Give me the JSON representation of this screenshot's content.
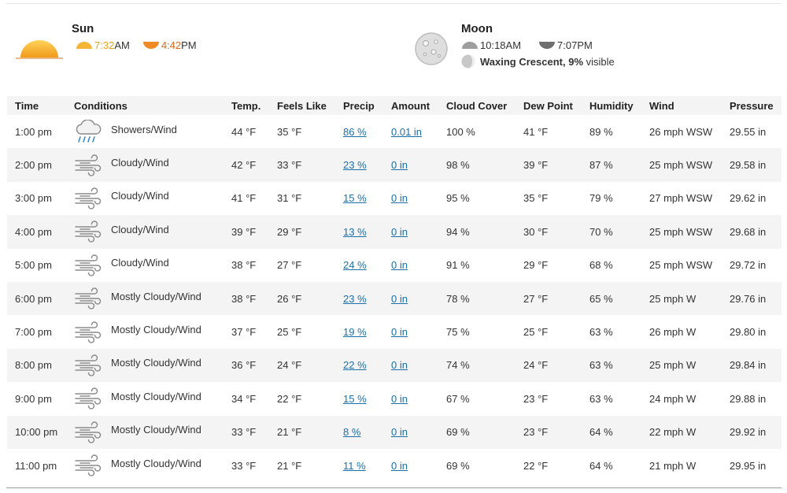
{
  "astronomy": {
    "sun": {
      "title": "Sun",
      "sunrise_time": "7:32",
      "sunrise_ampm": "AM",
      "sunset_time": "4:42",
      "sunset_ampm": "PM",
      "colors": {
        "sunrise": "#e8a317",
        "sunset": "#d2691e"
      }
    },
    "moon": {
      "title": "Moon",
      "moonrise": "10:18AM",
      "moonset": "7:07PM",
      "phase_name": "Waxing Crescent,",
      "phase_percent": "9%",
      "phase_suffix": "visible"
    }
  },
  "table": {
    "headers": [
      "Time",
      "Conditions",
      "Temp.",
      "Feels Like",
      "Precip",
      "Amount",
      "Cloud Cover",
      "Dew Point",
      "Humidity",
      "Wind",
      "Pressure"
    ],
    "rows": [
      {
        "time": "1:00 pm",
        "icon": "showers-wind-icon",
        "conditions": "Showers/Wind",
        "temp": "44 °F",
        "feels": "35 °F",
        "precip": "86 %",
        "amount": "0.01 in",
        "cloud": "100 %",
        "dew": "41 °F",
        "humidity": "89 %",
        "wind": "26 mph WSW",
        "pressure": "29.55 in"
      },
      {
        "time": "2:00 pm",
        "icon": "wind-icon",
        "conditions": "Cloudy/Wind",
        "temp": "42 °F",
        "feels": "33 °F",
        "precip": "23 %",
        "amount": "0 in",
        "cloud": "98 %",
        "dew": "39 °F",
        "humidity": "87 %",
        "wind": "25 mph WSW",
        "pressure": "29.58 in"
      },
      {
        "time": "3:00 pm",
        "icon": "wind-icon",
        "conditions": "Cloudy/Wind",
        "temp": "41 °F",
        "feels": "31 °F",
        "precip": "15 %",
        "amount": "0 in",
        "cloud": "95 %",
        "dew": "35 °F",
        "humidity": "79 %",
        "wind": "27 mph WSW",
        "pressure": "29.62 in"
      },
      {
        "time": "4:00 pm",
        "icon": "wind-icon",
        "conditions": "Cloudy/Wind",
        "temp": "39 °F",
        "feels": "29 °F",
        "precip": "13 %",
        "amount": "0 in",
        "cloud": "94 %",
        "dew": "30 °F",
        "humidity": "70 %",
        "wind": "25 mph WSW",
        "pressure": "29.68 in"
      },
      {
        "time": "5:00 pm",
        "icon": "wind-icon",
        "conditions": "Cloudy/Wind",
        "temp": "38 °F",
        "feels": "27 °F",
        "precip": "24 %",
        "amount": "0 in",
        "cloud": "91 %",
        "dew": "29 °F",
        "humidity": "68 %",
        "wind": "25 mph WSW",
        "pressure": "29.72 in"
      },
      {
        "time": "6:00 pm",
        "icon": "wind-icon",
        "conditions": "Mostly Cloudy/Wind",
        "temp": "38 °F",
        "feels": "26 °F",
        "precip": "23 %",
        "amount": "0 in",
        "cloud": "78 %",
        "dew": "27 °F",
        "humidity": "65 %",
        "wind": "25 mph W",
        "pressure": "29.76 in"
      },
      {
        "time": "7:00 pm",
        "icon": "wind-icon",
        "conditions": "Mostly Cloudy/Wind",
        "temp": "37 °F",
        "feels": "25 °F",
        "precip": "19 %",
        "amount": "0 in",
        "cloud": "75 %",
        "dew": "25 °F",
        "humidity": "63 %",
        "wind": "26 mph W",
        "pressure": "29.80 in"
      },
      {
        "time": "8:00 pm",
        "icon": "wind-icon",
        "conditions": "Mostly Cloudy/Wind",
        "temp": "36 °F",
        "feels": "24 °F",
        "precip": "22 %",
        "amount": "0 in",
        "cloud": "74 %",
        "dew": "24 °F",
        "humidity": "63 %",
        "wind": "25 mph W",
        "pressure": "29.84 in"
      },
      {
        "time": "9:00 pm",
        "icon": "wind-icon",
        "conditions": "Mostly Cloudy/Wind",
        "temp": "34 °F",
        "feels": "22 °F",
        "precip": "15 %",
        "amount": "0 in",
        "cloud": "67 %",
        "dew": "23 °F",
        "humidity": "63 %",
        "wind": "24 mph W",
        "pressure": "29.88 in"
      },
      {
        "time": "10:00 pm",
        "icon": "wind-icon",
        "conditions": "Mostly Cloudy/Wind",
        "temp": "33 °F",
        "feels": "21 °F",
        "precip": "8 %",
        "amount": "0 in",
        "cloud": "69 %",
        "dew": "23 °F",
        "humidity": "64 %",
        "wind": "22 mph W",
        "pressure": "29.92 in"
      },
      {
        "time": "11:00 pm",
        "icon": "wind-icon",
        "conditions": "Mostly Cloudy/Wind",
        "temp": "33 °F",
        "feels": "21 °F",
        "precip": "11 %",
        "amount": "0 in",
        "cloud": "69 %",
        "dew": "22 °F",
        "humidity": "64 %",
        "wind": "21 mph W",
        "pressure": "29.95 in"
      }
    ]
  },
  "colors": {
    "link": "#1a6fa8",
    "stripe": "#f4f4f4",
    "sun": "#f5b537",
    "sunset": "#f08a24",
    "moon": "#cfcfcf"
  }
}
